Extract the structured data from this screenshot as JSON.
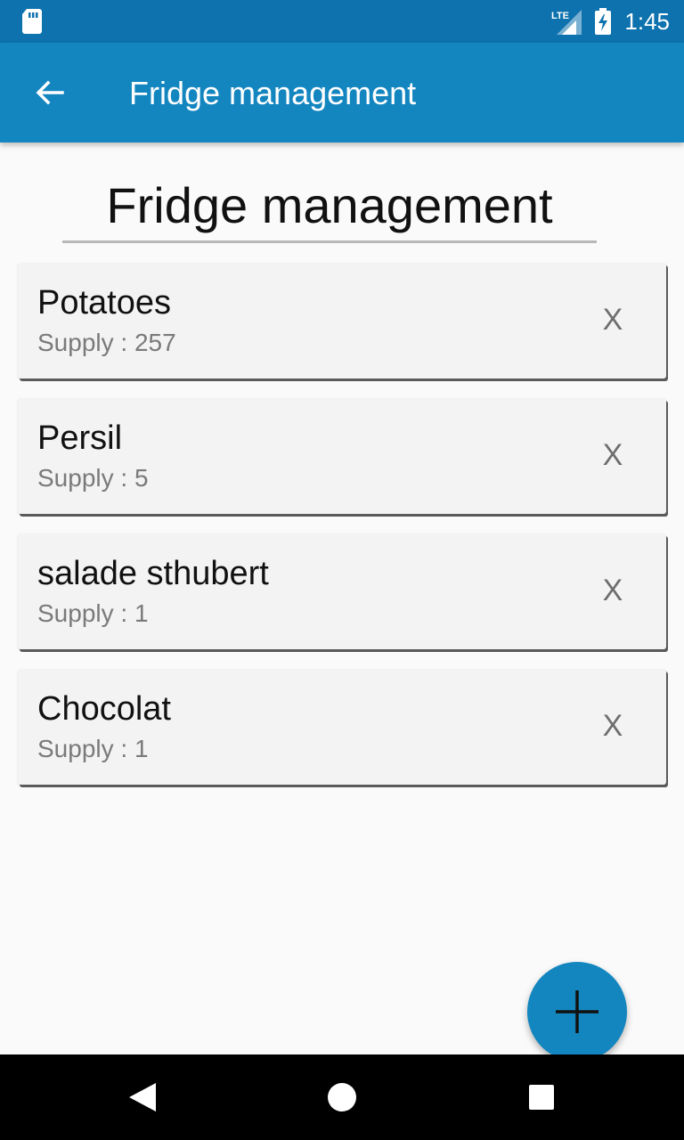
{
  "status_bar": {
    "time": "1:45",
    "network": "LTE",
    "icons": [
      "sd-card-icon",
      "lte-signal-icon",
      "battery-charging-icon"
    ]
  },
  "app_bar": {
    "title": "Fridge management",
    "back_icon": "arrow-back-icon"
  },
  "page": {
    "heading": "Fridge management"
  },
  "items": [
    {
      "name": "Potatoes",
      "supply_label": "Supply : ",
      "supply": "257",
      "delete_label": "X"
    },
    {
      "name": "Persil",
      "supply_label": "Supply : ",
      "supply": "5",
      "delete_label": "X"
    },
    {
      "name": "salade sthubert",
      "supply_label": "Supply : ",
      "supply": "1",
      "delete_label": "X"
    },
    {
      "name": "Chocolat",
      "supply_label": "Supply : ",
      "supply": "1",
      "delete_label": "X"
    }
  ],
  "fab": {
    "icon": "plus-icon"
  },
  "nav_bar": {
    "icons": [
      "back-triangle-icon",
      "home-circle-icon",
      "recents-square-icon"
    ]
  },
  "colors": {
    "status_bar": "#0d72ae",
    "app_bar": "#1386c0",
    "fab": "#1386c0",
    "background": "#fafafa",
    "card": "#f3f3f3"
  }
}
